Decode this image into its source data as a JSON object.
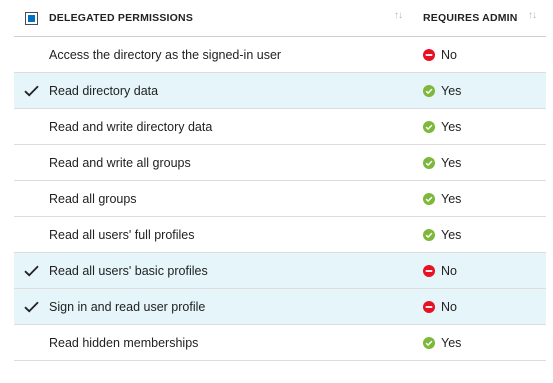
{
  "header": {
    "permissions_label": "DELEGATED PERMISSIONS",
    "admin_label": "REQUIRES ADMIN",
    "sort_glyph": "↑↓"
  },
  "rows": [
    {
      "name": "Access the directory as the signed-in user",
      "selected": false,
      "admin": "No",
      "admin_icon": "minus-circle-icon"
    },
    {
      "name": "Read directory data",
      "selected": true,
      "admin": "Yes",
      "admin_icon": "check-circle-icon"
    },
    {
      "name": "Read and write directory data",
      "selected": false,
      "admin": "Yes",
      "admin_icon": "check-circle-icon"
    },
    {
      "name": "Read and write all groups",
      "selected": false,
      "admin": "Yes",
      "admin_icon": "check-circle-icon"
    },
    {
      "name": "Read all groups",
      "selected": false,
      "admin": "Yes",
      "admin_icon": "check-circle-icon"
    },
    {
      "name": "Read all users' full profiles",
      "selected": false,
      "admin": "Yes",
      "admin_icon": "check-circle-icon"
    },
    {
      "name": "Read all users' basic profiles",
      "selected": true,
      "admin": "No",
      "admin_icon": "minus-circle-icon"
    },
    {
      "name": "Sign in and read user profile",
      "selected": true,
      "admin": "No",
      "admin_icon": "minus-circle-icon"
    },
    {
      "name": "Read hidden memberships",
      "selected": false,
      "admin": "Yes",
      "admin_icon": "check-circle-icon"
    }
  ],
  "colors": {
    "selected_row_bg": "#e5f5fa",
    "yes_green": "#7db83a",
    "no_red": "#e81123",
    "checkbox_blue": "#0072c6"
  }
}
